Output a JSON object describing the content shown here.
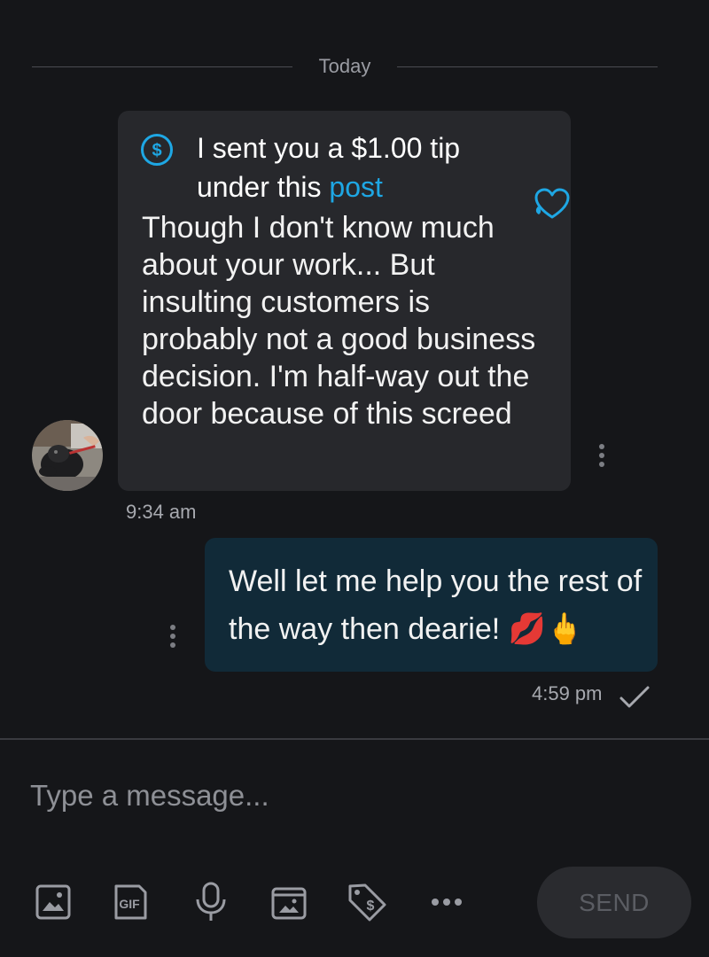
{
  "chat": {
    "date_divider": "Today",
    "incoming": {
      "tip_line1": "I sent you a $1.00 tip",
      "tip_line2_prefix": "under this ",
      "tip_link": "post",
      "message": "Though I don't know much about your work... But insulting customers is probably not a good business decision. I'm half-way out the door because of this screed",
      "time": "9:34 am",
      "avatar_icon": "dog-avatar",
      "tip_icon": "dollar-circle-icon",
      "like_icon": "heart-icon"
    },
    "outgoing": {
      "message": "Well let me help you the rest of the way then dearie! 💋🖕",
      "time": "4:59 pm",
      "status_icon": "check-icon"
    }
  },
  "composer": {
    "placeholder": "Type a message...",
    "send_label": "SEND",
    "gif_label": "GIF",
    "tools": [
      "image-icon",
      "gif-icon",
      "microphone-icon",
      "media-vault-icon",
      "tip-tag-icon",
      "more-icon"
    ]
  },
  "colors": {
    "background": "#151619",
    "incoming_bubble": "#27282c",
    "outgoing_bubble": "#112a38",
    "accent": "#1ea7e4",
    "muted_text": "#a7a9af"
  }
}
